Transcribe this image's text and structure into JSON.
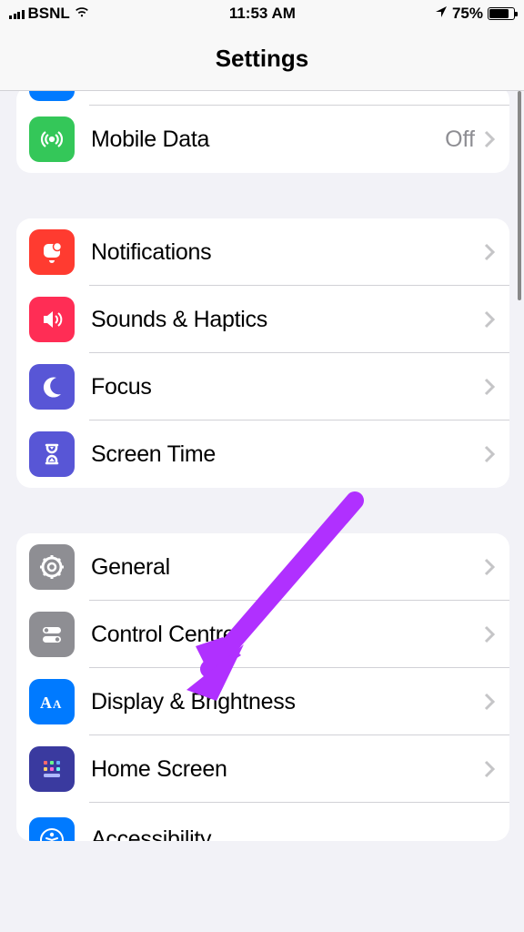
{
  "statusbar": {
    "carrier": "BSNL",
    "time": "11:53 AM",
    "battery_pct": "75%"
  },
  "header": {
    "title": "Settings"
  },
  "groups": [
    {
      "rows": [
        {
          "label": "",
          "value": "",
          "icon": "blue-cutoff"
        },
        {
          "label": "Mobile Data",
          "value": "Off",
          "icon": "antenna"
        }
      ]
    },
    {
      "rows": [
        {
          "label": "Notifications",
          "icon": "bell"
        },
        {
          "label": "Sounds & Haptics",
          "icon": "speaker"
        },
        {
          "label": "Focus",
          "icon": "moon"
        },
        {
          "label": "Screen Time",
          "icon": "hourglass"
        }
      ]
    },
    {
      "rows": [
        {
          "label": "General",
          "icon": "gear"
        },
        {
          "label": "Control Centre",
          "icon": "switches"
        },
        {
          "label": "Display & Brightness",
          "icon": "aa"
        },
        {
          "label": "Home Screen",
          "icon": "grid"
        },
        {
          "label": "Accessibility",
          "icon": "accessibility"
        }
      ]
    }
  ]
}
